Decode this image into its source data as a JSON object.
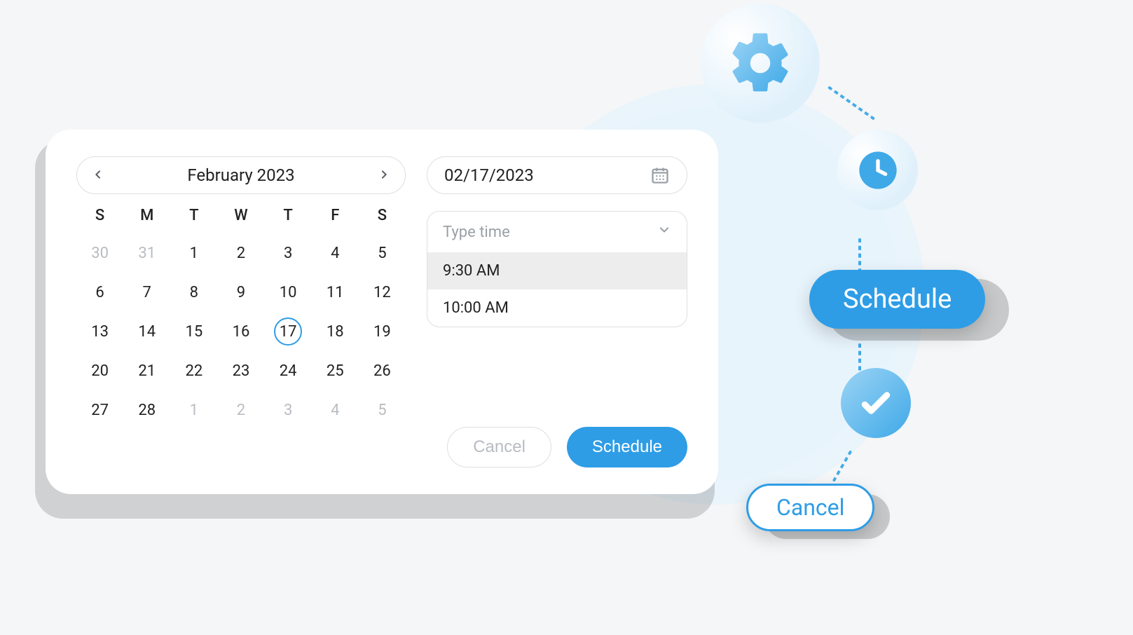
{
  "calendar": {
    "month_label": "February 2023",
    "weekdays": [
      "S",
      "M",
      "T",
      "W",
      "T",
      "F",
      "S"
    ],
    "cells": [
      {
        "n": "30",
        "other": true
      },
      {
        "n": "31",
        "other": true
      },
      {
        "n": "1"
      },
      {
        "n": "2"
      },
      {
        "n": "3"
      },
      {
        "n": "4"
      },
      {
        "n": "5"
      },
      {
        "n": "6"
      },
      {
        "n": "7"
      },
      {
        "n": "8"
      },
      {
        "n": "9"
      },
      {
        "n": "10"
      },
      {
        "n": "11"
      },
      {
        "n": "12"
      },
      {
        "n": "13"
      },
      {
        "n": "14"
      },
      {
        "n": "15"
      },
      {
        "n": "16"
      },
      {
        "n": "17",
        "selected": true
      },
      {
        "n": "18"
      },
      {
        "n": "19"
      },
      {
        "n": "20"
      },
      {
        "n": "21"
      },
      {
        "n": "22"
      },
      {
        "n": "23"
      },
      {
        "n": "24"
      },
      {
        "n": "25"
      },
      {
        "n": "26"
      },
      {
        "n": "27"
      },
      {
        "n": "28"
      },
      {
        "n": "1",
        "other": true
      },
      {
        "n": "2",
        "other": true
      },
      {
        "n": "3",
        "other": true
      },
      {
        "n": "4",
        "other": true
      },
      {
        "n": "5",
        "other": true
      }
    ]
  },
  "date_field": {
    "value": "02/17/2023"
  },
  "time_select": {
    "placeholder": "Type time",
    "options": [
      {
        "label": "9:30 AM",
        "selected": true
      },
      {
        "label": "10:00 AM",
        "selected": false
      }
    ]
  },
  "buttons": {
    "cancel": "Cancel",
    "schedule": "Schedule"
  },
  "decor": {
    "schedule_pill": "Schedule",
    "cancel_pill": "Cancel"
  },
  "colors": {
    "accent": "#2e9de6"
  }
}
